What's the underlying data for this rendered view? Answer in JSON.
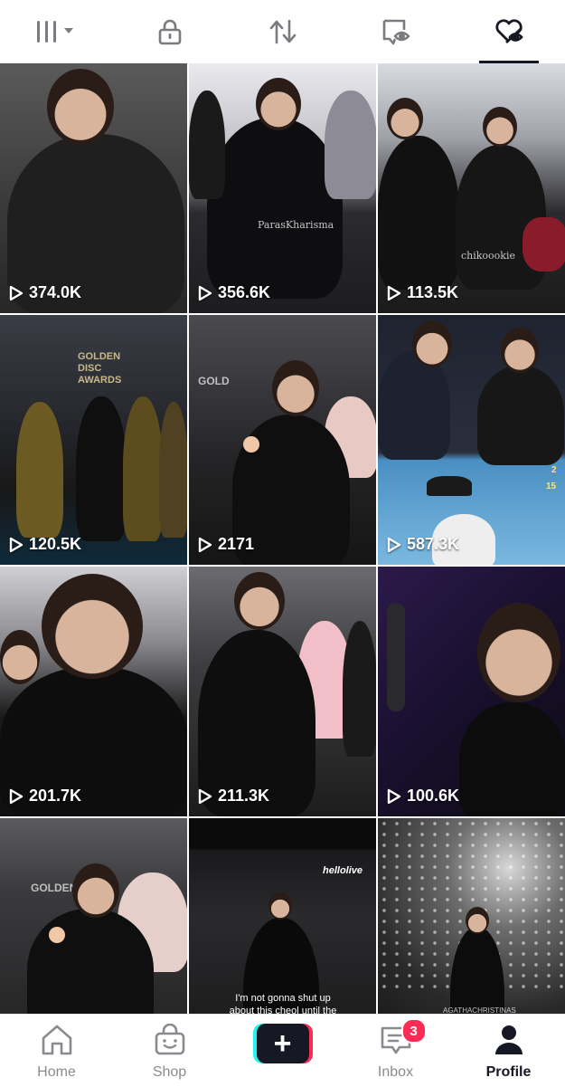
{
  "top_tabs": [
    {
      "icon": "grid-icon"
    },
    {
      "icon": "lock-icon"
    },
    {
      "icon": "repost-icon"
    },
    {
      "icon": "tagged-eye-icon"
    },
    {
      "icon": "liked-heart-icon"
    }
  ],
  "videos": [
    {
      "views": "374.0K"
    },
    {
      "views": "356.6K",
      "watermark": "ParasKharisma"
    },
    {
      "views": "113.5K",
      "watermark": "chikoookie"
    },
    {
      "views": "120.5K",
      "stage_text": "GOLDEN DISC AWARDS"
    },
    {
      "views": "2171",
      "stage_text": "GOLD"
    },
    {
      "views": "587.3K",
      "corner_numbers": [
        "2",
        "15"
      ]
    },
    {
      "views": "201.7K"
    },
    {
      "views": "211.3K"
    },
    {
      "views": "100.6K"
    },
    {
      "stage_text": "GOLDEN"
    },
    {
      "logo": "hellolive",
      "caption": "I'm not gonna shut up about this cheol until the next gda"
    },
    {
      "watermark": "AGATHACHRISTINAS"
    }
  ],
  "bottom_nav": {
    "home": "Home",
    "shop": "Shop",
    "inbox": "Inbox",
    "inbox_badge": "3",
    "profile": "Profile"
  },
  "colors": {
    "active": "#161823",
    "inactive": "#8a8b91",
    "badge": "#fe2c55",
    "cyan": "#25f4ee"
  }
}
